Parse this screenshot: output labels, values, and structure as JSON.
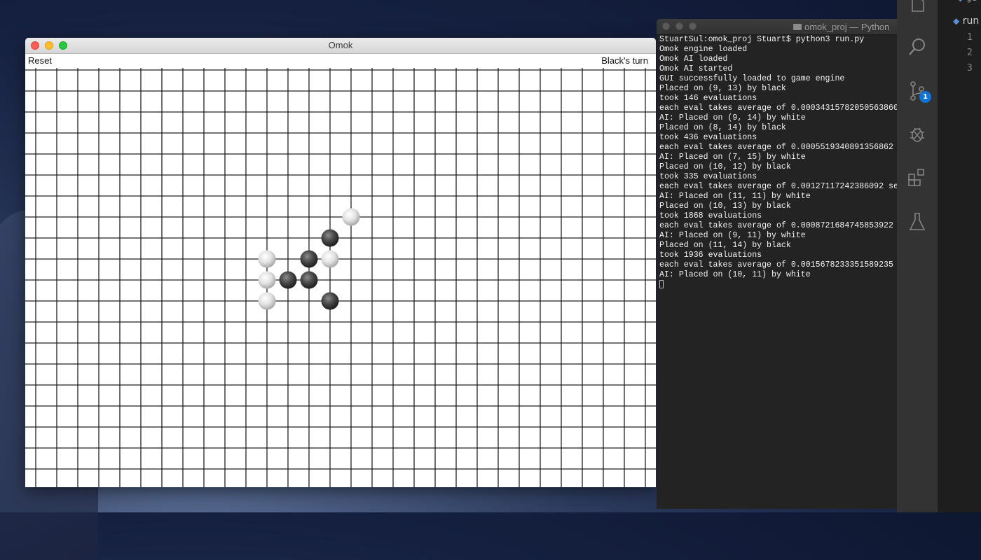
{
  "omok": {
    "window_title": "Omok",
    "reset_label": "Reset",
    "turn_text": "Black's turn",
    "stones": [
      {
        "color": "white",
        "col": 15,
        "row": 7
      },
      {
        "color": "black",
        "col": 14,
        "row": 8
      },
      {
        "color": "white",
        "col": 11,
        "row": 9
      },
      {
        "color": "black",
        "col": 13,
        "row": 9
      },
      {
        "color": "white",
        "col": 14,
        "row": 9
      },
      {
        "color": "white",
        "col": 11,
        "row": 10
      },
      {
        "color": "black",
        "col": 12,
        "row": 10
      },
      {
        "color": "black",
        "col": 13,
        "row": 10
      },
      {
        "color": "white",
        "col": 11,
        "row": 11
      },
      {
        "color": "black",
        "col": 14,
        "row": 11
      }
    ]
  },
  "terminal": {
    "title": "omok_proj — Python",
    "lines": [
      "StuartSul:omok_proj Stuart$ python3 run.py",
      "Omok engine loaded",
      "Omok AI loaded",
      "Omok AI started",
      "GUI successfully loaded to game engine",
      "Placed on (9, 13) by black",
      "took 146 evaluations",
      "each eval takes average of 0.00034315782050563860",
      "AI: Placed on (9, 14) by white",
      "Placed on (8, 14) by black",
      "took 436 evaluations",
      "each eval takes average of 0.0005519340891356862",
      "AI: Placed on (7, 15) by white",
      "Placed on (10, 12) by black",
      "took 335 evaluations",
      "each eval takes average of 0.00127117242386092 se",
      "AI: Placed on (11, 11) by white",
      "Placed on (10, 13) by black",
      "took 1868 evaluations",
      "each eval takes average of 0.0008721684745853922",
      "AI: Placed on (9, 11) by white",
      "Placed on (11, 14) by black",
      "took 1936 evaluations",
      "each eval takes average of 0.0015678233351589235",
      "AI: Placed on (10, 11) by white"
    ]
  },
  "vscode": {
    "tab_label": "run",
    "prev_tab_label": "ge",
    "line_numbers": [
      "1",
      "2",
      "3"
    ],
    "scm_badge": "1",
    "activity_icons": [
      "files-icon",
      "search-icon",
      "source-control-icon",
      "debug-icon",
      "extensions-icon",
      "flask-icon"
    ]
  }
}
